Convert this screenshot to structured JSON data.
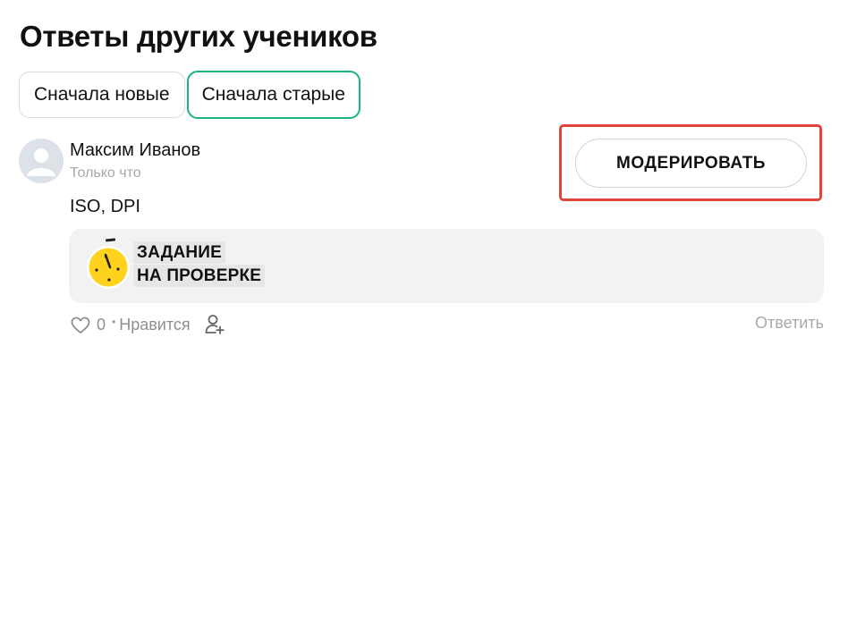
{
  "section": {
    "title": "Ответы других учеников"
  },
  "sort_tabs": [
    {
      "label": "Сначала новые",
      "active": false
    },
    {
      "label": "Сначала старые",
      "active": true
    }
  ],
  "answer": {
    "author": "Максим Иванов",
    "timestamp": "Только что",
    "text": "ISO, DPI",
    "moderate_label": "МОДЕРИРОВАТЬ",
    "status_lines": [
      "ЗАДАНИЕ",
      "НА ПРОВЕРКЕ"
    ],
    "likes_count": "0",
    "like_label": "Нравится",
    "reply_label": "Ответить"
  },
  "icons": {
    "avatar": "user-placeholder-avatar",
    "status": "stopwatch-icon",
    "like": "heart-icon",
    "subscribe": "add-user-icon"
  },
  "colors": {
    "active_tab_border": "#1bb381",
    "highlight_frame": "#e0443a",
    "stopwatch_yellow": "#ffd21e",
    "card_background": "#f2f2f2"
  }
}
